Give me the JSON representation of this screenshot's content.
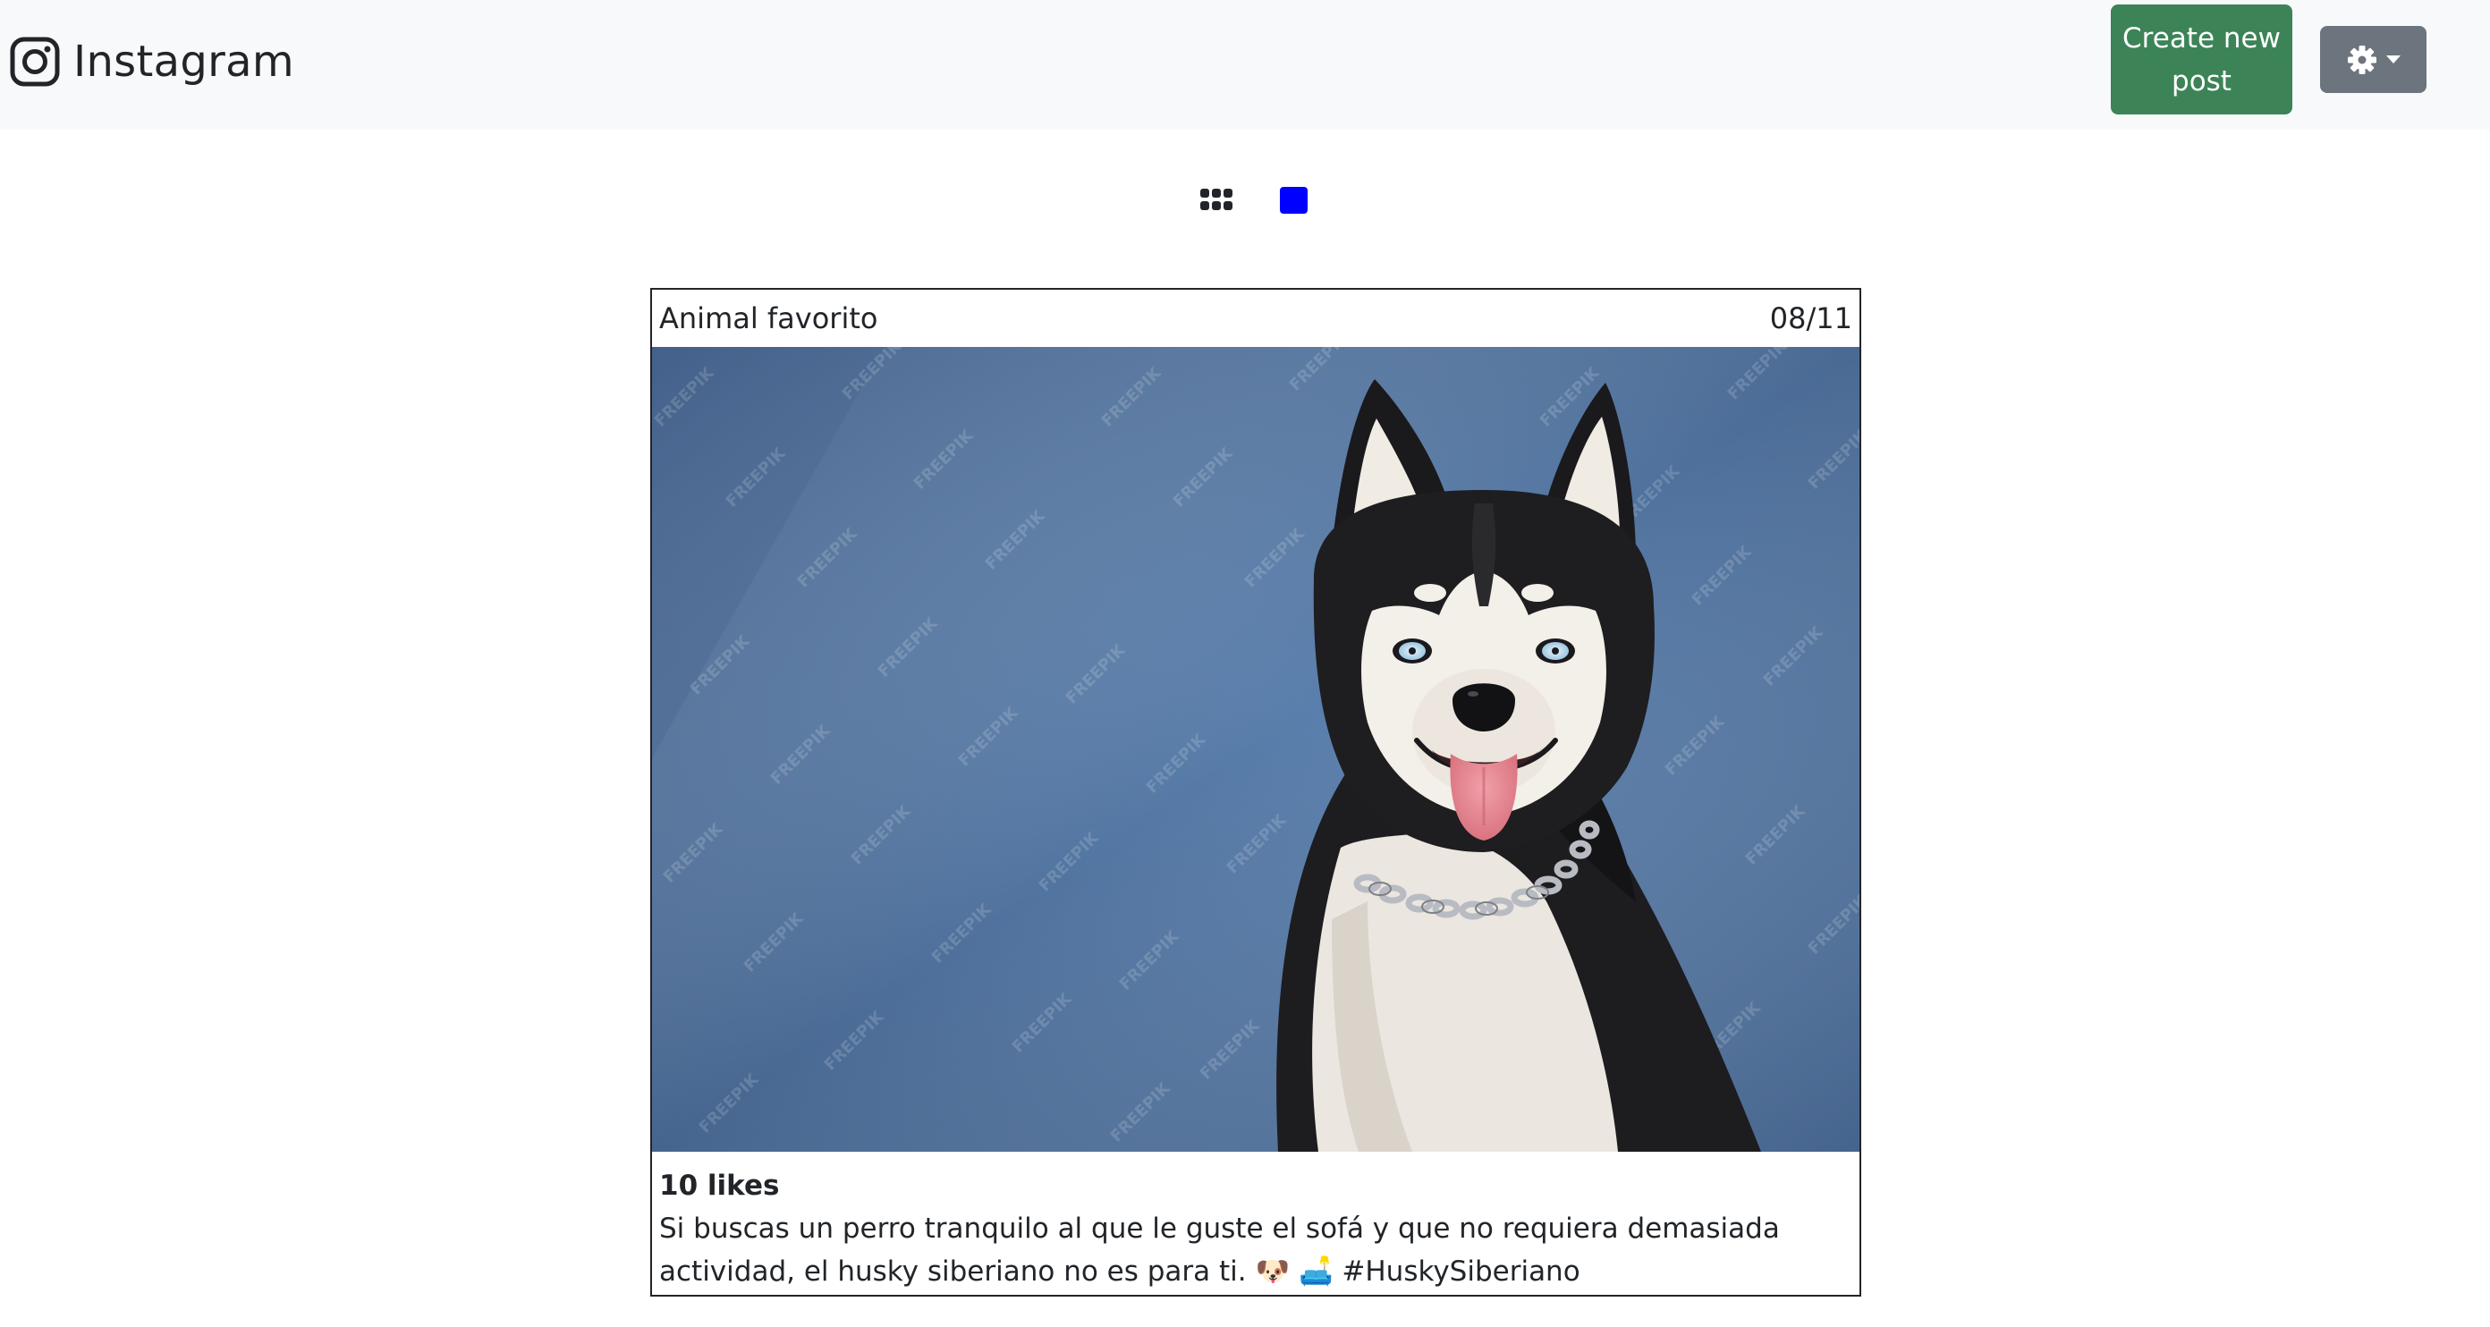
{
  "brand": {
    "name": "Instagram",
    "icon": "instagram-icon"
  },
  "header": {
    "create_label": "Create new post",
    "settings_icon": "gear-icon",
    "dropdown_icon": "caret-down-icon"
  },
  "view_toggle": {
    "grid_icon": "grid-icon",
    "single_icon": "single-post-icon",
    "active": "single",
    "active_color": "#0000ff"
  },
  "post": {
    "title": "Animal favorito",
    "date": "08/11",
    "image_alt": "Siberian husky sitting against a blue background",
    "image_watermark": "FREEPIK",
    "likes": "10 likes",
    "caption": "Si buscas un perro tranquilo al que le guste el sofá y que no requiera demasiada actividad, el husky siberiano no es para ti. 🐶 🛋️ #HuskySiberiano"
  },
  "colors": {
    "navbar_bg": "#f8f9fa",
    "create_button": "#3c8457",
    "settings_button": "#6c757d",
    "image_bg": "#4d6e97"
  }
}
